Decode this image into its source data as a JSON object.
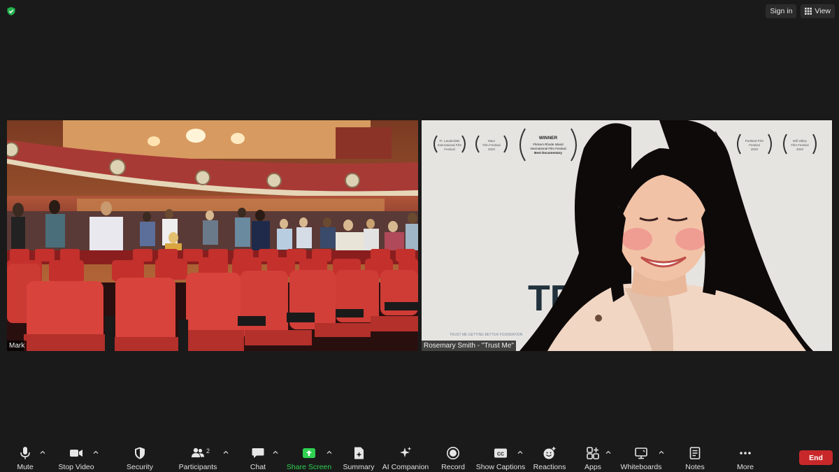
{
  "top_bar": {
    "sign_in_label": "Sign in",
    "view_label": "View",
    "security_icon": "shield-check-icon"
  },
  "video_tiles": [
    {
      "participant_name": "Mark",
      "scene": "theater-auditorium-with-standing-audience"
    },
    {
      "participant_name": "Rosemary Smith - \"Trust Me\"",
      "scene": "woman-smiling-in-front-of-film-poster"
    }
  ],
  "poster": {
    "laurels": [
      "Ft. Lauderdale International Film Festival 2020",
      "Maui Film Festival 2020",
      "WINNER Flickers Rhode Island International Film Festival Best Documentary",
      "Portland Film Festival 2020",
      "Mill Valley Film Festival 2020"
    ],
    "title_fragment": "TR"
  },
  "toolbar": {
    "items": [
      {
        "label": "Mute",
        "icon": "microphone-icon",
        "has_caret": true
      },
      {
        "label": "Stop Video",
        "icon": "video-camera-icon",
        "has_caret": true
      },
      {
        "label": "Security",
        "icon": "shield-icon",
        "has_caret": false
      },
      {
        "label": "Participants",
        "icon": "participants-icon",
        "has_caret": true,
        "count": "2"
      },
      {
        "label": "Chat",
        "icon": "chat-bubble-icon",
        "has_caret": true
      },
      {
        "label": "Share Screen",
        "icon": "share-screen-icon",
        "has_caret": true
      },
      {
        "label": "Summary",
        "icon": "summary-document-icon",
        "has_caret": false
      },
      {
        "label": "AI Companion",
        "icon": "sparkle-icon",
        "has_caret": false
      },
      {
        "label": "Record",
        "icon": "record-icon",
        "has_caret": false
      },
      {
        "label": "Show Captions",
        "icon": "closed-captions-icon",
        "has_caret": true
      },
      {
        "label": "Reactions",
        "icon": "emoji-icon",
        "has_caret": false
      },
      {
        "label": "Apps",
        "icon": "apps-icon",
        "has_caret": true
      },
      {
        "label": "Whiteboards",
        "icon": "whiteboard-icon",
        "has_caret": true
      },
      {
        "label": "Notes",
        "icon": "notes-icon",
        "has_caret": false
      },
      {
        "label": "More",
        "icon": "more-dots-icon",
        "has_caret": false
      }
    ],
    "end_label": "End"
  },
  "colors": {
    "background": "#1a1a1a",
    "share_screen_green": "#2fd152",
    "end_red": "#c9282a"
  }
}
